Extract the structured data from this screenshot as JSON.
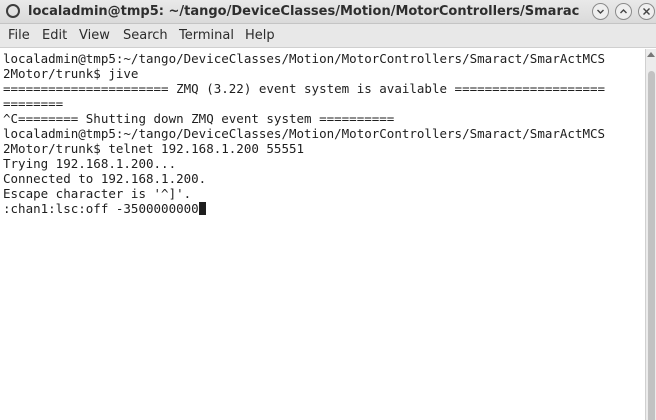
{
  "window": {
    "title": "localadmin@tmp5: ~/tango/DeviceClasses/Motion/MotorControllers/Smarac",
    "app_icon": "terminal-circle-icon",
    "controls": [
      "minimize-icon",
      "maximize-icon",
      "close-icon"
    ]
  },
  "menubar": {
    "file": "File",
    "edit": "Edit",
    "view": "View",
    "search": "Search",
    "terminal": "Terminal",
    "help": "Help"
  },
  "terminal": {
    "lines": [
      "localadmin@tmp5:~/tango/DeviceClasses/Motion/MotorControllers/Smaract/SmarActMCS",
      "2Motor/trunk$ jive",
      "====================== ZMQ (3.22) event system is available ====================",
      "========",
      "^C======== Shutting down ZMQ event system ==========",
      "localadmin@tmp5:~/tango/DeviceClasses/Motion/MotorControllers/Smaract/SmarActMCS",
      "2Motor/trunk$ telnet 192.168.1.200 55551",
      "Trying 192.168.1.200...",
      "Connected to 192.168.1.200.",
      "Escape character is '^]'.",
      ":chan1:lsc:off -3500000000"
    ]
  },
  "colors": {
    "background": "#ffffff",
    "text": "#1e1e1e",
    "titlebar": "#e2e2e2",
    "menubar": "#e8e8e8"
  }
}
